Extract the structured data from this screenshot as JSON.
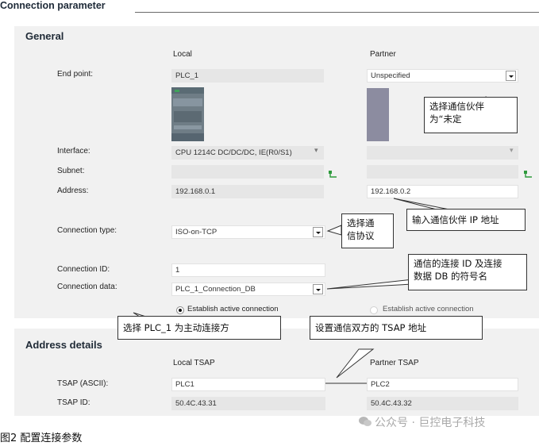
{
  "header": {
    "title": "Connection parameter"
  },
  "general": {
    "title": "General",
    "local_col": "Local",
    "partner_col": "Partner",
    "end_point": {
      "label": "End point:",
      "local": "PLC_1",
      "partner": "Unspecified"
    },
    "interface": {
      "label": "Interface:",
      "local": "CPU 1214C DC/DC/DC, IE(R0/S1)",
      "partner": ""
    },
    "subnet": {
      "label": "Subnet:",
      "local": "",
      "partner": ""
    },
    "address": {
      "label": "Address:",
      "local": "192.168.0.1",
      "partner": "192.168.0.2"
    },
    "connection_type": {
      "label": "Connection type:",
      "value": "ISO-on-TCP"
    },
    "connection_id": {
      "label": "Connection ID:",
      "value": "1"
    },
    "connection_data": {
      "label": "Connection data:",
      "value": "PLC_1_Connection_DB"
    },
    "radio_local": "Establish active connection",
    "radio_partner": "Establish active connection"
  },
  "address_details": {
    "title": "Address details",
    "local_col": "Local TSAP",
    "partner_col": "Partner TSAP",
    "tsap_ascii": {
      "label": "TSAP (ASCII):",
      "local": "PLC1",
      "partner": "PLC2"
    },
    "tsap_id": {
      "label": "TSAP ID:",
      "local": "50.4C.43.31",
      "partner": "50.4C.43.32"
    }
  },
  "callouts": {
    "partner": "选择通信伙伴\n为“未定",
    "protocol": "选择通\n信协议",
    "ip": "输入通信伙伴 IP 地址",
    "conn_id": "通信的连接 ID 及连接\n数据 DB 的符号名",
    "active": "选择 PLC_1 为主动连接方",
    "tsap": "设置通信双方的 TSAP 地址"
  },
  "caption": "图2 配置连接参数",
  "watermark": "公众号 · 巨控电子科技",
  "colors": {
    "panel": "#f1f1f1",
    "field_grey": "#e6e6e6",
    "partner_block": "#8c8ca0",
    "net_green": "#2e9a3c"
  }
}
